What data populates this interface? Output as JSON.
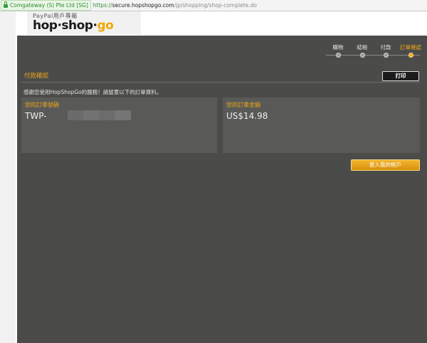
{
  "browser": {
    "cert_label": "Comgateway (S) Pte Ltd [SG]",
    "url_scheme": "https://",
    "url_host": "secure.hopshopgo.com",
    "url_path": "/jp/shopping/shop-complete.do"
  },
  "header": {
    "logo_subtitle": "PayPal用戶專屬",
    "logo_text_a": "hop·shop·",
    "logo_text_b": "go"
  },
  "steps": [
    {
      "label": "購物",
      "active": false
    },
    {
      "label": "結帳",
      "active": false
    },
    {
      "label": "付款",
      "active": false
    },
    {
      "label": "訂單確認",
      "active": true
    }
  ],
  "section": {
    "title": "付款確認",
    "print_label": "打印",
    "thanks_text": "感謝您使用HopShopGo的服務！請留意以下的訂單資料。"
  },
  "order": {
    "number_label": "您的訂單號碼",
    "number_value": "TWP-"
  },
  "amount": {
    "label": "您的訂單金額",
    "value": "US$14.98"
  },
  "actions": {
    "login_label": "登入我的帳戶"
  },
  "colors": {
    "accent": "#f0a814",
    "panel": "#4b4c4a",
    "box": "#595a58"
  }
}
